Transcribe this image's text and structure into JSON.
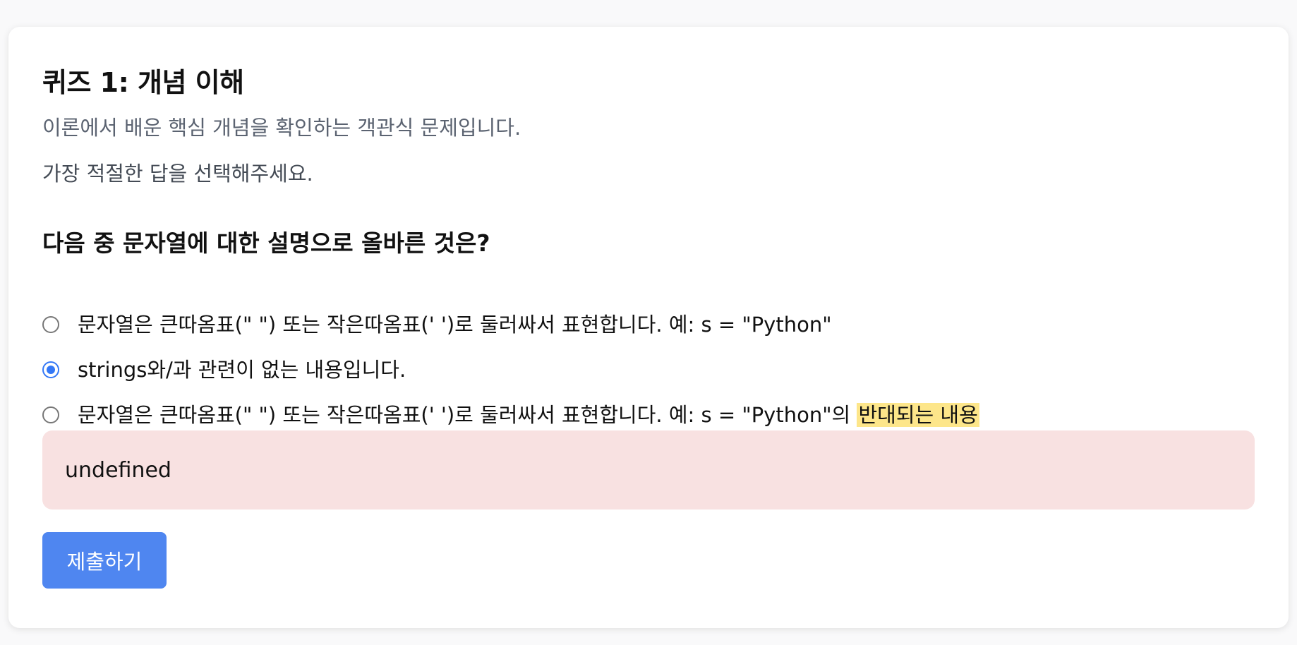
{
  "quiz": {
    "title": "퀴즈 1: 개념 이해",
    "subtitle": "이론에서 배운 핵심 개념을 확인하는 객관식 문제입니다.",
    "instruction": "가장 적절한 답을 선택해주세요.",
    "question": "다음 중 문자열에 대한 설명으로 올바른 것은?",
    "options": [
      {
        "label": "문자열은 큰따옴표(\" \") 또는 작은따옴표(' ')로 둘러싸서 표현합니다. 예: s = \"Python\"",
        "selected": false
      },
      {
        "label": "strings와/과 관련이 없는 내용입니다.",
        "selected": true
      },
      {
        "label": "문자열은 큰따옴표(\" \") 또는 작은따옴표(' ')로 둘러싸서 표현합니다. 예: s = \"Python\"의 ",
        "highlight": "반대되는 내용",
        "selected": false
      }
    ],
    "feedback": "undefined",
    "submit_label": "제출하기"
  },
  "colors": {
    "accent": "#3478f6",
    "button": "#4f86f0",
    "feedback_bg": "#f8e1e1",
    "highlight": "#fde68a"
  }
}
